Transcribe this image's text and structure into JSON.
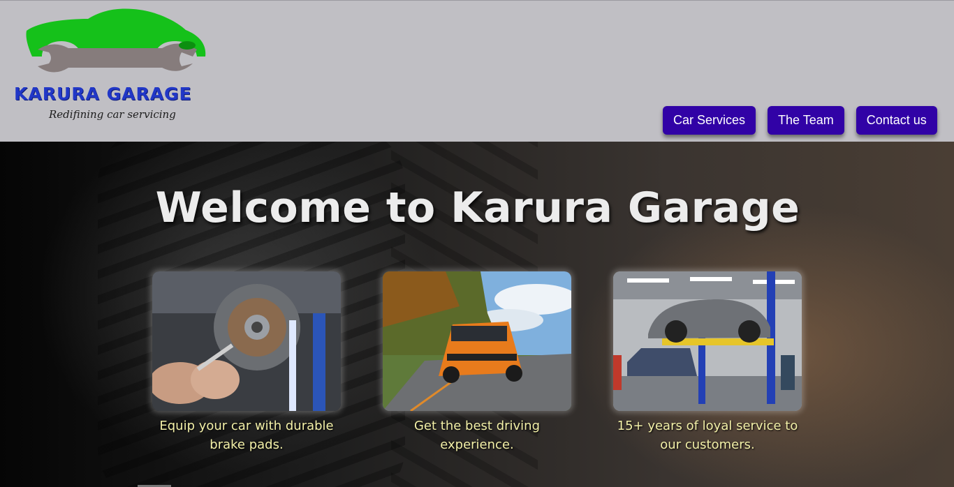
{
  "brand": {
    "name": "KARURA  GARAGE",
    "tagline": "Redifining car servicing",
    "logo_icon": "car-wrench-logo",
    "colors": {
      "car": "#15c11a",
      "wrench": "#867c7c",
      "text": "#2137c7"
    }
  },
  "nav": {
    "items": [
      {
        "label": "Car Services"
      },
      {
        "label": "The Team"
      },
      {
        "label": "Contact us"
      }
    ],
    "button_color": "#3102a6"
  },
  "hero": {
    "title": "Welcome to Karura Garage",
    "cards": [
      {
        "image": "brake-disc-repair-photo",
        "caption": "Equip your car with durable brake pads."
      },
      {
        "image": "orange-suv-driving-photo",
        "caption": "Get the best driving experience."
      },
      {
        "image": "car-on-lift-workshop-photo",
        "caption": "15+ years of loyal service to our customers."
      }
    ],
    "caption_color": "#f3f0a8"
  }
}
